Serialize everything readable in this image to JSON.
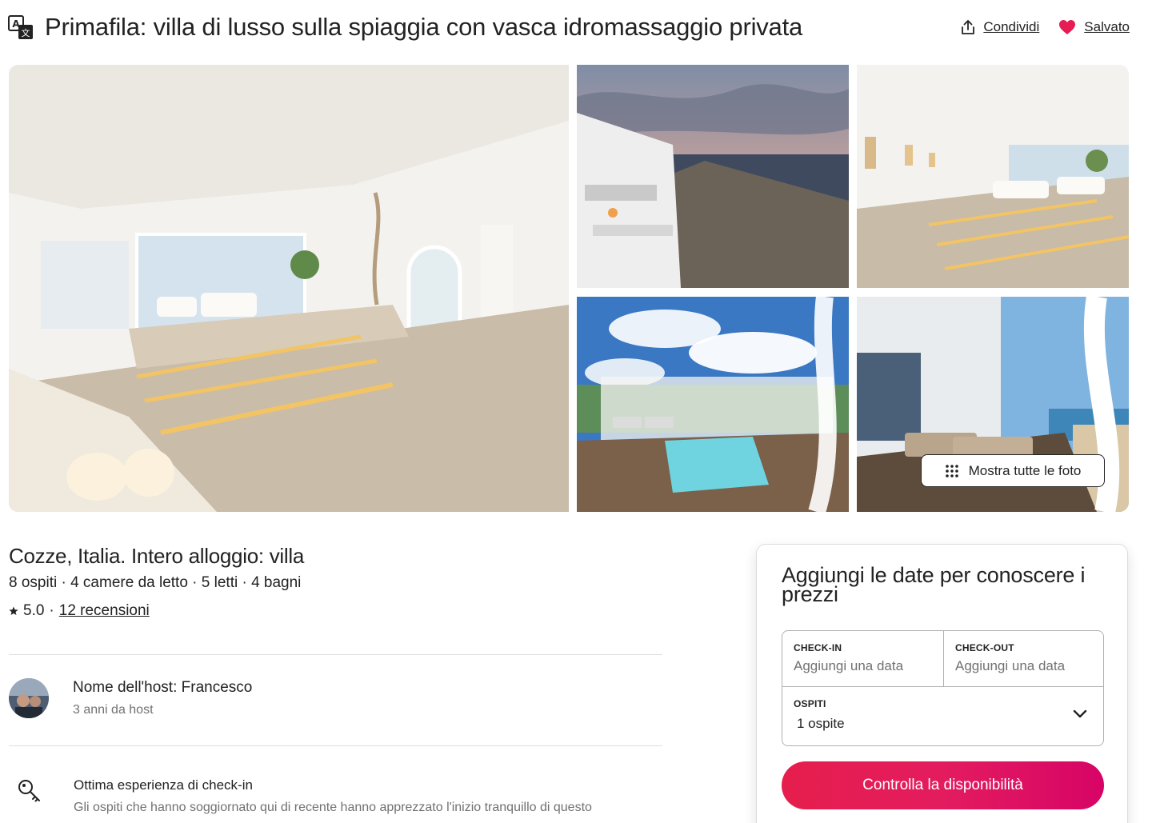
{
  "header": {
    "title": "Primafila: villa di lusso sulla spiaggia con vasca idromassaggio privata",
    "share_label": "Condividi",
    "saved_label": "Salvato",
    "saved_color": "#e51d53"
  },
  "gallery": {
    "show_all_label": "Mostra tutte le foto"
  },
  "listing": {
    "location_title": "Cozze, Italia. Intero alloggio: villa",
    "specs": "8 ospiti · 4 camere da letto · 5 letti · 4 bagni",
    "rating": "5.0",
    "rating_sep": "·",
    "reviews_label": "12 recensioni"
  },
  "host": {
    "name": "Nome dell'host: Francesco",
    "years": "3 anni da host"
  },
  "highlight": {
    "title": "Ottima esperienza di check-in",
    "description": "Gli ospiti che hanno soggiornato qui di recente hanno apprezzato l'inizio tranquillo di questo"
  },
  "booking": {
    "title": "Aggiungi le date per conoscere i prezzi",
    "checkin_label": "CHECK-IN",
    "checkin_value": "Aggiungi una data",
    "checkout_label": "CHECK-OUT",
    "checkout_value": "Aggiungi una data",
    "guests_label": "OSPITI",
    "guests_value": "1 ospite",
    "cta_label": "Controlla la disponibilità",
    "cta_color": "#e31c5f"
  }
}
